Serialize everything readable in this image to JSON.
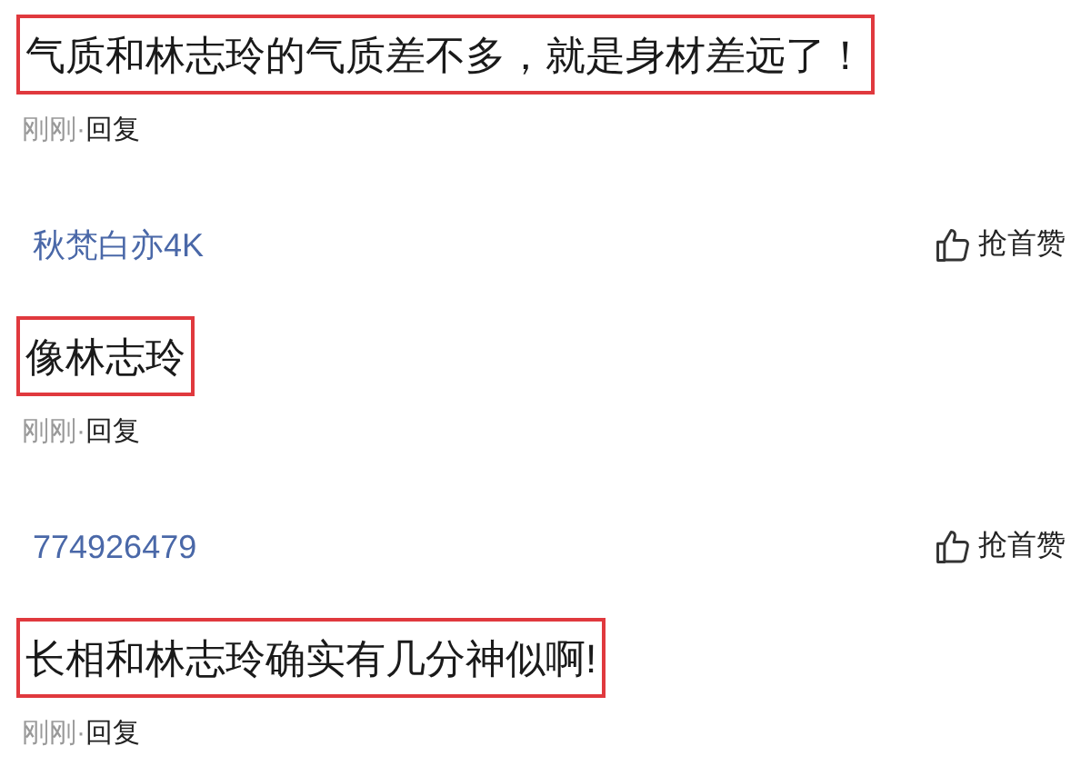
{
  "comments": [
    {
      "text": "气质和林志玲的气质差不多，就是身材差远了！",
      "highlighted": true,
      "time": "刚刚·",
      "reply": "回复"
    },
    {
      "author": "秋梵白亦4K",
      "like": "抢首赞",
      "text": "像林志玲",
      "highlighted": true,
      "time": "刚刚·",
      "reply": "回复"
    },
    {
      "author": "774926479",
      "like": "抢首赞",
      "text": "长相和林志玲确实有几分神似啊!",
      "highlighted": true,
      "time": "刚刚·",
      "reply": "回复"
    }
  ]
}
